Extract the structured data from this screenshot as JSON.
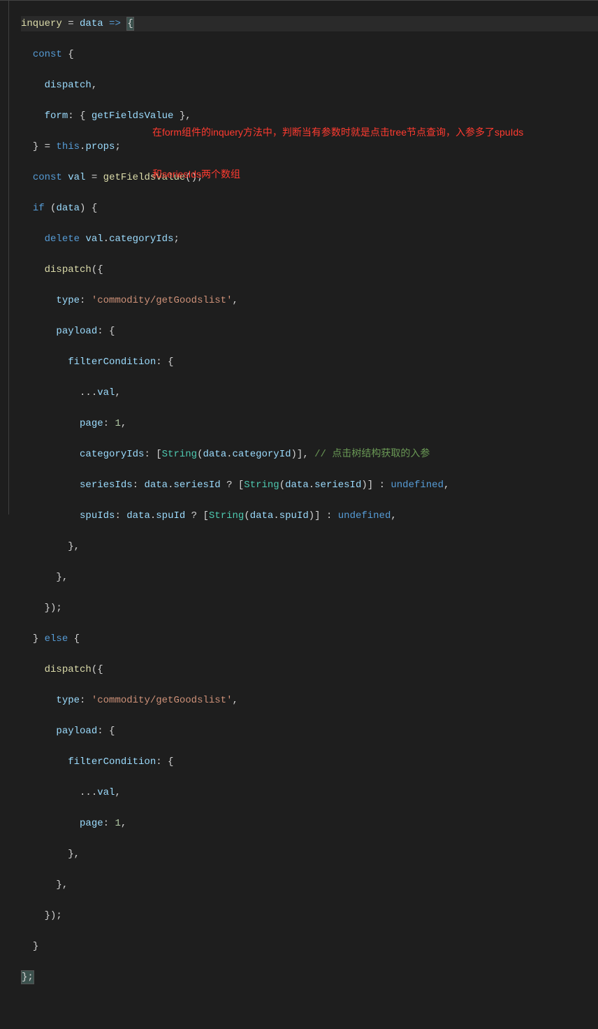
{
  "annotation": {
    "line1": "在form组件的inquery方法中，判断当有参数时就是点击tree节点查询，入参多了spuIds",
    "line2": "和seriesIds两个数组"
  },
  "code": {
    "l1_inquery": "inquery",
    "l1_eq": " = ",
    "l1_data": "data",
    "l1_arrow": " => ",
    "l1_brace": "{",
    "l2_const": "const",
    "l2_brace": " {",
    "l3_dispatch": "dispatch",
    "l3_comma": ",",
    "l4_form": "form",
    "l4_colon": ": { ",
    "l4_getfv": "getFieldsValue",
    "l4_end": " },",
    "l5_close": "} = ",
    "l5_this": "this",
    "l5_dot": ".",
    "l5_props": "props",
    "l5_semi": ";",
    "l6_const": "const",
    "l6_sp": " ",
    "l6_val": "val",
    "l6_eq": " = ",
    "l6_getfv": "getFieldsValue",
    "l6_call": "();",
    "l7_if": "if",
    "l7_open": " (",
    "l7_data": "data",
    "l7_close": ") {",
    "l8_delete": "delete",
    "l8_sp": " ",
    "l8_val": "val",
    "l8_dot": ".",
    "l8_cat": "categoryIds",
    "l8_semi": ";",
    "l9_dispatch": "dispatch",
    "l9_open": "({",
    "l10_type": "type",
    "l10_colon": ": ",
    "l10_str": "'commodity/getGoodslist'",
    "l10_comma": ",",
    "l11_payload": "payload",
    "l11_colon": ": {",
    "l12_filter": "filterCondition",
    "l12_colon": ": {",
    "l13_spread": "...",
    "l13_val": "val",
    "l13_comma": ",",
    "l14_page": "page",
    "l14_colon": ": ",
    "l14_num": "1",
    "l14_comma": ",",
    "l15_cat": "categoryIds",
    "l15_colon": ": [",
    "l15_string": "String",
    "l15_open": "(",
    "l15_data": "data",
    "l15_dot": ".",
    "l15_catid": "categoryId",
    "l15_close": ")], ",
    "l15_cmt": "// 点击树结构获取的入参",
    "l16_ser": "seriesIds",
    "l16_colon": ": ",
    "l16_data1": "data",
    "l16_dot1": ".",
    "l16_serid1": "seriesId",
    "l16_q": " ? [",
    "l16_string": "String",
    "l16_open": "(",
    "l16_data2": "data",
    "l16_dot2": ".",
    "l16_serid2": "seriesId",
    "l16_close": ")] : ",
    "l16_undef": "undefined",
    "l16_comma": ",",
    "l17_spu": "spuIds",
    "l17_colon": ": ",
    "l17_data1": "data",
    "l17_dot1": ".",
    "l17_spuid1": "spuId",
    "l17_q": " ? [",
    "l17_string": "String",
    "l17_open": "(",
    "l17_data2": "data",
    "l17_dot2": ".",
    "l17_spuid2": "spuId",
    "l17_close": ")] : ",
    "l17_undef": "undefined",
    "l17_comma": ",",
    "l18_close": "},",
    "l19_close": "},",
    "l20_close": "});",
    "l21_close": "} ",
    "l21_else": "else",
    "l21_open": " {",
    "l22_dispatch": "dispatch",
    "l22_open": "({",
    "l23_type": "type",
    "l23_colon": ": ",
    "l23_str": "'commodity/getGoodslist'",
    "l23_comma": ",",
    "l24_payload": "payload",
    "l24_colon": ": {",
    "l25_filter": "filterCondition",
    "l25_colon": ": {",
    "l26_spread": "...",
    "l26_val": "val",
    "l26_comma": ",",
    "l27_page": "page",
    "l27_colon": ": ",
    "l27_num": "1",
    "l27_comma": ",",
    "l28_close": "},",
    "l29_close": "},",
    "l30_close": "});",
    "l31_close": "}",
    "l32_close": "};"
  }
}
